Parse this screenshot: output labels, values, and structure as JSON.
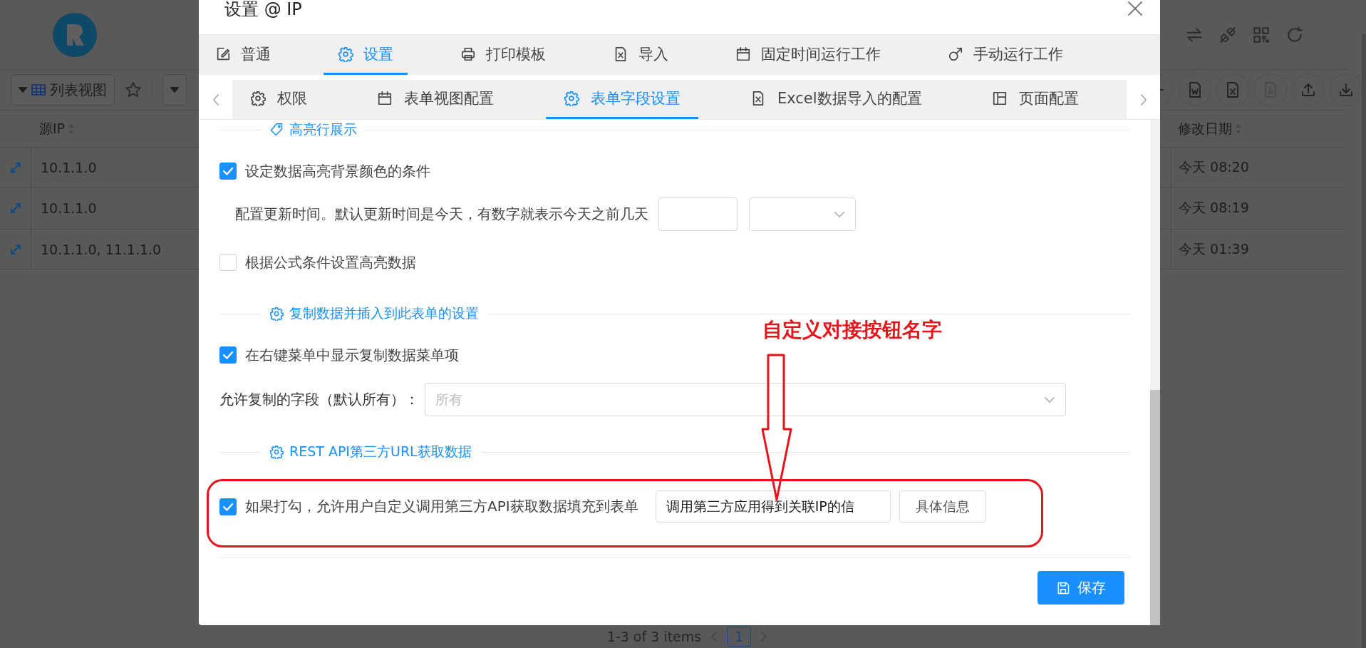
{
  "app": {
    "toolbar": {
      "view_button": "列表视图"
    },
    "table": {
      "columns": [
        {
          "label": "源IP"
        },
        {
          "label": "修改日期"
        }
      ],
      "rows": [
        {
          "source_ip": "10.1.1.0",
          "modified": "今天 08:20"
        },
        {
          "source_ip": "10.1.1.0",
          "modified": "今天 08:19"
        },
        {
          "source_ip": "10.1.1.0, 11.1.1.0",
          "modified": "今天 01:39"
        }
      ]
    },
    "pagination": {
      "summary": "1-3 of 3 items",
      "pages": [
        {
          "label": "1",
          "selected": true
        }
      ]
    }
  },
  "dialog": {
    "title": "设置 @ IP",
    "tabs": [
      {
        "label": "普通",
        "selected": false
      },
      {
        "label": "设置",
        "selected": true
      },
      {
        "label": "打印模板",
        "selected": false
      },
      {
        "label": "导入",
        "selected": false
      },
      {
        "label": "固定时间运行工作",
        "selected": false
      },
      {
        "label": "手动运行工作",
        "selected": false
      }
    ],
    "subtabs": [
      {
        "label": "权限",
        "selected": false
      },
      {
        "label": "表单视图配置",
        "selected": false
      },
      {
        "label": "表单字段设置",
        "selected": true
      },
      {
        "label": "Excel数据导入的配置",
        "selected": false
      },
      {
        "label": "页面配置",
        "selected": false
      }
    ],
    "sections": [
      {
        "kind": "divider",
        "title": "高亮行展示"
      },
      {
        "kind": "checkbox",
        "label": "设定数据高亮背景颜色的条件",
        "checked": true
      },
      {
        "kind": "day-offset",
        "label": "配置更新时间。默认更新时间是今天，有数字就表示今天之前几天"
      },
      {
        "kind": "checkbox",
        "label": "根据公式条件设置高亮数据",
        "checked": false
      },
      {
        "kind": "divider",
        "title": "复制数据并插入到此表单的设置"
      },
      {
        "kind": "checkbox",
        "label": "在右键菜单中显示复制数据菜单项",
        "checked": true
      },
      {
        "kind": "select",
        "label": "允许复制的字段（默认所有）：",
        "placeholder": "所有"
      },
      {
        "kind": "divider",
        "title": "REST API第三方URL获取数据"
      },
      {
        "kind": "checkbox-input",
        "label": "如果打勾，允许用户自定义调用第三方API获取数据填充到表单",
        "checked": true,
        "value": "调用第三方应用得到关联IP的信",
        "button": "具体信息"
      }
    ],
    "save_button": "保存"
  },
  "annotation": {
    "text": "自定义对接按钮名字"
  }
}
